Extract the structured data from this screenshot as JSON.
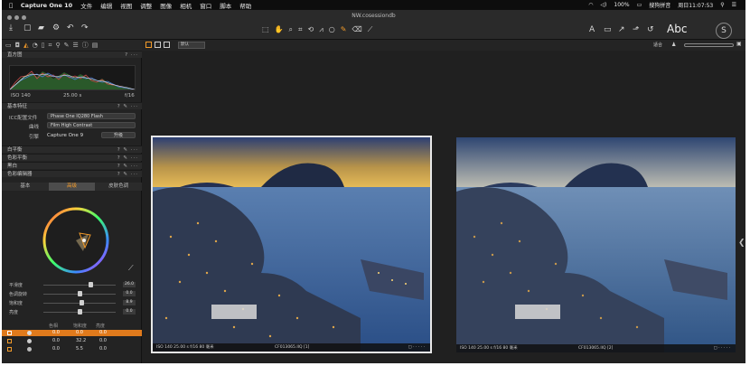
{
  "menubar": {
    "app_name": "Capture One 10",
    "items": [
      "文件",
      "编辑",
      "视图",
      "调整",
      "图像",
      "相机",
      "窗口",
      "脚本",
      "帮助"
    ],
    "battery": "100%",
    "input_method": "搜狗拼音",
    "clock": "周日11:07:53"
  },
  "toolbar": {
    "doc_title": "NW.cosessiondb",
    "text_icon": "Abc"
  },
  "viewbar": {
    "filter_label": "默认",
    "zoom": "适合"
  },
  "panel": {
    "histogram_title": "直方图",
    "hist_iso": "ISO 140",
    "hist_shutter": "25.00 s",
    "hist_aperture": "f/16",
    "base_title": "基本特征",
    "icc_label": "ICC配置文件",
    "icc_value": "Phase One IQ280 Flash",
    "curve_label": "曲线",
    "curve_value": "Film High Contrast",
    "engine_label": "引擎",
    "engine_value": "Capture One 9",
    "engine_button": "升级",
    "sec_white_balance": "白平衡",
    "sec_color_balance": "色彩平衡",
    "sec_bw": "黑白",
    "sec_color_editor": "色彩编辑器",
    "color_tabs": [
      "基本",
      "高级",
      "皮肤色调"
    ],
    "sliders": [
      {
        "label": "平滑度",
        "value": "26.0",
        "pos": 0.65
      },
      {
        "label": "色调旋转",
        "value": "0.0",
        "pos": 0.5
      },
      {
        "label": "饱和度",
        "value": "8.9",
        "pos": 0.53
      },
      {
        "label": "亮度",
        "value": "0.0",
        "pos": 0.5
      }
    ],
    "list_headers": [
      "色相",
      "饱和度",
      "亮度"
    ],
    "list_rows": [
      {
        "h": "0.0",
        "s": "0.0",
        "l": "0.0"
      },
      {
        "h": "0.0",
        "s": "32.2",
        "l": "0.0"
      },
      {
        "h": "0.0",
        "s": "5.5",
        "l": "0.0"
      }
    ]
  },
  "photos": [
    {
      "meta": "ISO 140    25.00 s    f/16    80 毫米",
      "file": "CF013065.IIQ [1]"
    },
    {
      "meta": "ISO 140    25.00 s    f/16    80 毫米",
      "file": "CF013065.IIQ [2]"
    }
  ],
  "colors": {
    "accent": "#f39b2a",
    "selected_row": "#e07a1c"
  }
}
